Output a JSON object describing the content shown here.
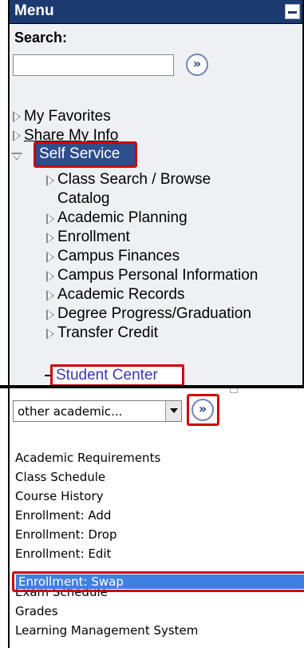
{
  "menu": {
    "title": "Menu",
    "search_label": "Search:",
    "search_value": "",
    "go_glyph": "»",
    "items": [
      {
        "label": "My Favorites"
      },
      {
        "label": "Share My Info"
      },
      {
        "label": "Self Service"
      }
    ],
    "sub_items": [
      {
        "label": "Class Search / Browse"
      },
      {
        "label": "Catalog"
      },
      {
        "label": "Academic Planning"
      },
      {
        "label": "Enrollment"
      },
      {
        "label": "Campus Finances"
      },
      {
        "label": "Campus Personal Information"
      },
      {
        "label": "Academic Records"
      },
      {
        "label": "Degree Progress/Graduation"
      },
      {
        "label": "Transfer Credit"
      },
      {
        "label": "Student Center"
      }
    ]
  },
  "dropdown": {
    "selected": "other academic...",
    "go_glyph": "»",
    "options": [
      "Academic Requirements",
      "Class Schedule",
      "Course History",
      "Enrollment: Add",
      "Enrollment: Drop",
      "Enrollment: Edit",
      "Enrollment: Swap",
      "Exam Schedule",
      "Grades",
      "Learning Management System"
    ]
  },
  "colors": {
    "header_bg": "#1b3b70",
    "highlight_red": "#d00000",
    "selected_bg": "#3d80e0",
    "link_blue": "#3a3ab0"
  }
}
